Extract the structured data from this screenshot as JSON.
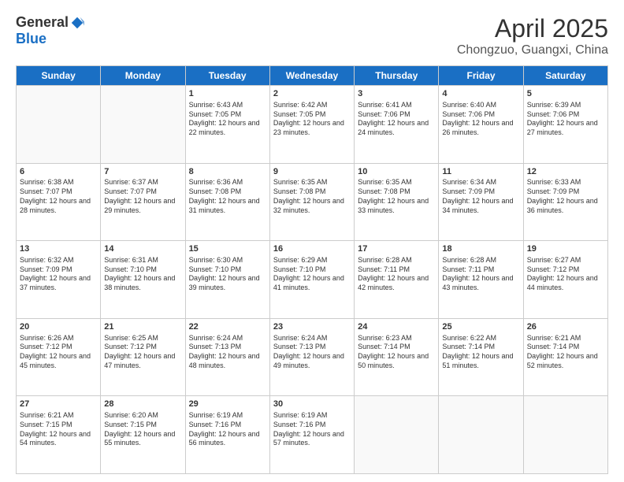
{
  "logo": {
    "general": "General",
    "blue": "Blue"
  },
  "title": "April 2025",
  "location": "Chongzuo, Guangxi, China",
  "days_of_week": [
    "Sunday",
    "Monday",
    "Tuesday",
    "Wednesday",
    "Thursday",
    "Friday",
    "Saturday"
  ],
  "weeks": [
    [
      {
        "day": "",
        "sunrise": "",
        "sunset": "",
        "daylight": ""
      },
      {
        "day": "",
        "sunrise": "",
        "sunset": "",
        "daylight": ""
      },
      {
        "day": "1",
        "sunrise": "Sunrise: 6:43 AM",
        "sunset": "Sunset: 7:05 PM",
        "daylight": "Daylight: 12 hours and 22 minutes."
      },
      {
        "day": "2",
        "sunrise": "Sunrise: 6:42 AM",
        "sunset": "Sunset: 7:05 PM",
        "daylight": "Daylight: 12 hours and 23 minutes."
      },
      {
        "day": "3",
        "sunrise": "Sunrise: 6:41 AM",
        "sunset": "Sunset: 7:06 PM",
        "daylight": "Daylight: 12 hours and 24 minutes."
      },
      {
        "day": "4",
        "sunrise": "Sunrise: 6:40 AM",
        "sunset": "Sunset: 7:06 PM",
        "daylight": "Daylight: 12 hours and 26 minutes."
      },
      {
        "day": "5",
        "sunrise": "Sunrise: 6:39 AM",
        "sunset": "Sunset: 7:06 PM",
        "daylight": "Daylight: 12 hours and 27 minutes."
      }
    ],
    [
      {
        "day": "6",
        "sunrise": "Sunrise: 6:38 AM",
        "sunset": "Sunset: 7:07 PM",
        "daylight": "Daylight: 12 hours and 28 minutes."
      },
      {
        "day": "7",
        "sunrise": "Sunrise: 6:37 AM",
        "sunset": "Sunset: 7:07 PM",
        "daylight": "Daylight: 12 hours and 29 minutes."
      },
      {
        "day": "8",
        "sunrise": "Sunrise: 6:36 AM",
        "sunset": "Sunset: 7:08 PM",
        "daylight": "Daylight: 12 hours and 31 minutes."
      },
      {
        "day": "9",
        "sunrise": "Sunrise: 6:35 AM",
        "sunset": "Sunset: 7:08 PM",
        "daylight": "Daylight: 12 hours and 32 minutes."
      },
      {
        "day": "10",
        "sunrise": "Sunrise: 6:35 AM",
        "sunset": "Sunset: 7:08 PM",
        "daylight": "Daylight: 12 hours and 33 minutes."
      },
      {
        "day": "11",
        "sunrise": "Sunrise: 6:34 AM",
        "sunset": "Sunset: 7:09 PM",
        "daylight": "Daylight: 12 hours and 34 minutes."
      },
      {
        "day": "12",
        "sunrise": "Sunrise: 6:33 AM",
        "sunset": "Sunset: 7:09 PM",
        "daylight": "Daylight: 12 hours and 36 minutes."
      }
    ],
    [
      {
        "day": "13",
        "sunrise": "Sunrise: 6:32 AM",
        "sunset": "Sunset: 7:09 PM",
        "daylight": "Daylight: 12 hours and 37 minutes."
      },
      {
        "day": "14",
        "sunrise": "Sunrise: 6:31 AM",
        "sunset": "Sunset: 7:10 PM",
        "daylight": "Daylight: 12 hours and 38 minutes."
      },
      {
        "day": "15",
        "sunrise": "Sunrise: 6:30 AM",
        "sunset": "Sunset: 7:10 PM",
        "daylight": "Daylight: 12 hours and 39 minutes."
      },
      {
        "day": "16",
        "sunrise": "Sunrise: 6:29 AM",
        "sunset": "Sunset: 7:10 PM",
        "daylight": "Daylight: 12 hours and 41 minutes."
      },
      {
        "day": "17",
        "sunrise": "Sunrise: 6:28 AM",
        "sunset": "Sunset: 7:11 PM",
        "daylight": "Daylight: 12 hours and 42 minutes."
      },
      {
        "day": "18",
        "sunrise": "Sunrise: 6:28 AM",
        "sunset": "Sunset: 7:11 PM",
        "daylight": "Daylight: 12 hours and 43 minutes."
      },
      {
        "day": "19",
        "sunrise": "Sunrise: 6:27 AM",
        "sunset": "Sunset: 7:12 PM",
        "daylight": "Daylight: 12 hours and 44 minutes."
      }
    ],
    [
      {
        "day": "20",
        "sunrise": "Sunrise: 6:26 AM",
        "sunset": "Sunset: 7:12 PM",
        "daylight": "Daylight: 12 hours and 45 minutes."
      },
      {
        "day": "21",
        "sunrise": "Sunrise: 6:25 AM",
        "sunset": "Sunset: 7:12 PM",
        "daylight": "Daylight: 12 hours and 47 minutes."
      },
      {
        "day": "22",
        "sunrise": "Sunrise: 6:24 AM",
        "sunset": "Sunset: 7:13 PM",
        "daylight": "Daylight: 12 hours and 48 minutes."
      },
      {
        "day": "23",
        "sunrise": "Sunrise: 6:24 AM",
        "sunset": "Sunset: 7:13 PM",
        "daylight": "Daylight: 12 hours and 49 minutes."
      },
      {
        "day": "24",
        "sunrise": "Sunrise: 6:23 AM",
        "sunset": "Sunset: 7:14 PM",
        "daylight": "Daylight: 12 hours and 50 minutes."
      },
      {
        "day": "25",
        "sunrise": "Sunrise: 6:22 AM",
        "sunset": "Sunset: 7:14 PM",
        "daylight": "Daylight: 12 hours and 51 minutes."
      },
      {
        "day": "26",
        "sunrise": "Sunrise: 6:21 AM",
        "sunset": "Sunset: 7:14 PM",
        "daylight": "Daylight: 12 hours and 52 minutes."
      }
    ],
    [
      {
        "day": "27",
        "sunrise": "Sunrise: 6:21 AM",
        "sunset": "Sunset: 7:15 PM",
        "daylight": "Daylight: 12 hours and 54 minutes."
      },
      {
        "day": "28",
        "sunrise": "Sunrise: 6:20 AM",
        "sunset": "Sunset: 7:15 PM",
        "daylight": "Daylight: 12 hours and 55 minutes."
      },
      {
        "day": "29",
        "sunrise": "Sunrise: 6:19 AM",
        "sunset": "Sunset: 7:16 PM",
        "daylight": "Daylight: 12 hours and 56 minutes."
      },
      {
        "day": "30",
        "sunrise": "Sunrise: 6:19 AM",
        "sunset": "Sunset: 7:16 PM",
        "daylight": "Daylight: 12 hours and 57 minutes."
      },
      {
        "day": "",
        "sunrise": "",
        "sunset": "",
        "daylight": ""
      },
      {
        "day": "",
        "sunrise": "",
        "sunset": "",
        "daylight": ""
      },
      {
        "day": "",
        "sunrise": "",
        "sunset": "",
        "daylight": ""
      }
    ]
  ]
}
